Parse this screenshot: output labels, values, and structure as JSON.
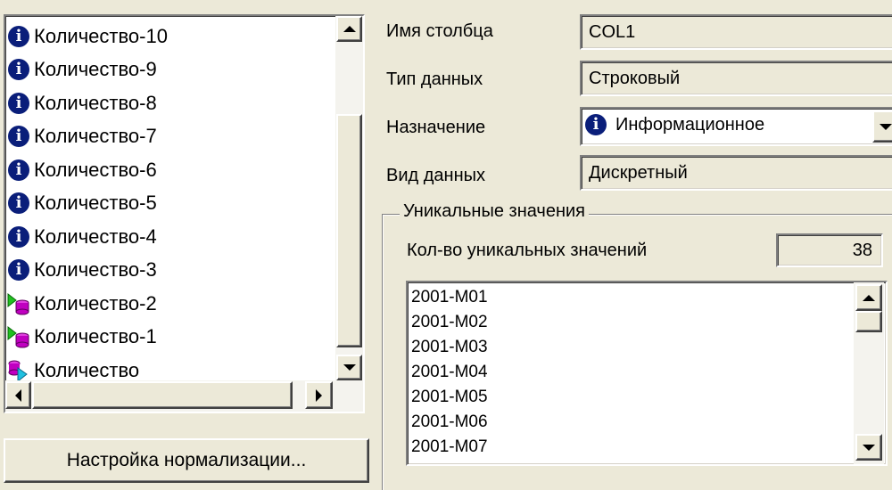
{
  "tree": {
    "items": [
      {
        "label": "Количество-10",
        "icon": "info-icon"
      },
      {
        "label": "Количество-9",
        "icon": "info-icon"
      },
      {
        "label": "Количество-8",
        "icon": "info-icon"
      },
      {
        "label": "Количество-7",
        "icon": "info-icon"
      },
      {
        "label": "Количество-6",
        "icon": "info-icon"
      },
      {
        "label": "Количество-5",
        "icon": "info-icon"
      },
      {
        "label": "Количество-4",
        "icon": "info-icon"
      },
      {
        "label": "Количество-3",
        "icon": "info-icon"
      },
      {
        "label": "Количество-2",
        "icon": "input-cylinder-icon"
      },
      {
        "label": "Количество-1",
        "icon": "input-cylinder-icon"
      },
      {
        "label": "Количество",
        "icon": "output-cylinder-icon"
      }
    ]
  },
  "normalization_button": "Настройка нормализации...",
  "properties": {
    "column_name_label": "Имя столбца",
    "column_name_value": "COL1",
    "data_type_label": "Тип данных",
    "data_type_value": "Строковый",
    "purpose_label": "Назначение",
    "purpose_value": "Информационное",
    "data_kind_label": "Вид данных",
    "data_kind_value": "Дискретный"
  },
  "unique_values": {
    "group_title": "Уникальные значения",
    "count_label": "Кол-во уникальных значений",
    "count_value": "38",
    "values": [
      "2001-M01",
      "2001-M02",
      "2001-M03",
      "2001-M04",
      "2001-M05",
      "2001-M06",
      "2001-M07"
    ]
  },
  "colors": {
    "info_icon": "#0a1e7a",
    "cylinder": "#c000c0",
    "arrow_green": "#20c020",
    "arrow_cyan": "#20c0e0",
    "background": "#ece9d8"
  }
}
